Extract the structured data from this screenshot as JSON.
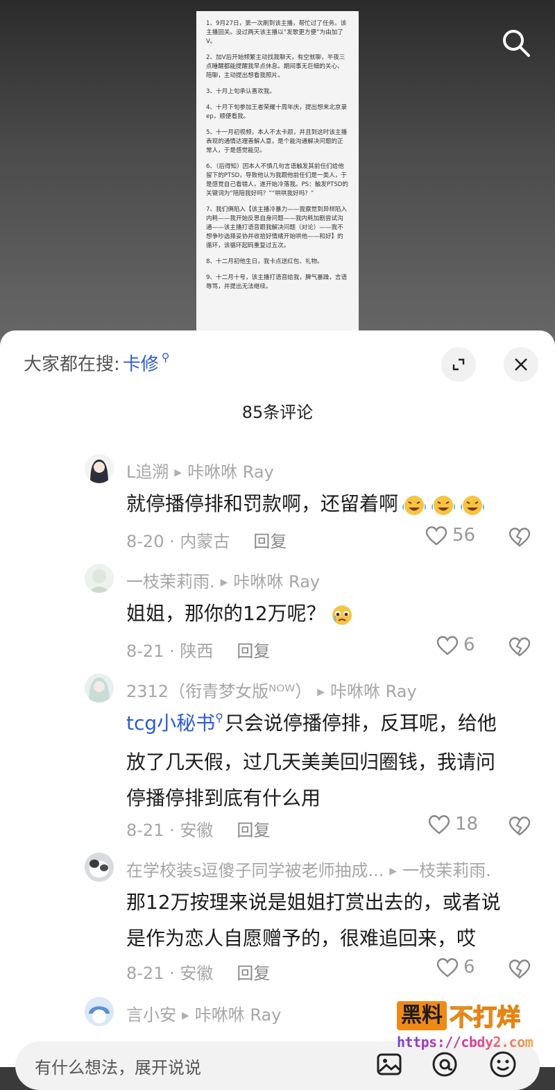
{
  "document": {
    "paragraphs": [
      "1、9月27日，第一次刷到该主播，帮忙过了任务。该主播回关。没过两天该主播以“发歌更方便”为由加了V。",
      "2、加V后开始频繁主动找我聊天，有空就聊，半夜三点睡醒都能提醒我早点休息。期间事无巨细的关心、陪聊，主动提出想看我照片。",
      "3、十月上旬承认喜欢我。",
      "4、十月下旬参加王者荣耀十周年庆，提出想来北京录ep，顺便看我。",
      "5、十一月初视频，本人不太卡颜，并且到这时该主播表现的通情达理善解人意，是个能沟通解决问题的正常人，于是感觉能见。",
      "6、（后得知）因本人不慎几句言语触发其前任们给他留下的PTSD，导致他认为我跟他前任们是一类人，于是感觉自己看错人，遂开始冷落我。PS：触发PTSD的关键词为“陪陪我好吗？”“哄哄我好吗？”",
      "7、我们俩陷入【该主播冷暴力——我察觉到异样陷入内耗——我开始反思自身问题——我内耗加剧尝试沟通——该主播打语音跟我解决问题（对论）——我不想争吵选择妥协并收拾好情绪开始哄他——和好】的循环，该循环起码重复过五次。",
      "8、十二月初他生日，我卡点送红包、礼物。",
      "9、十二月十号，该主播打语音给我，脾气暴躁，言语辱骂，并提出无法继续。"
    ]
  },
  "header": {
    "hot_search_prefix": "大家都在搜:",
    "hot_search_term": "卡修",
    "comment_count": "85条评论"
  },
  "comments": [
    {
      "user": "L追溯",
      "reply_to": "咔咻咻 Ray",
      "text": "就停播停排和罚款啊，还留着啊",
      "emoji": "cry-laugh-emoji x3",
      "date_loc": "8-20 · 内蒙古",
      "reply": "回复",
      "likes": "56"
    },
    {
      "user": "一枝茉莉雨.",
      "reply_to": "咔咻咻 Ray",
      "text": "姐姐，那你的12万呢？",
      "emoji": "pleading-emoji",
      "date_loc": "8-21 · 陕西",
      "reply": "回复",
      "likes": "6"
    },
    {
      "user": "2312（衔青梦女版ᴺᴼᵂ）",
      "reply_to": "咔咻咻 Ray",
      "mention": "tcg小秘书",
      "text_lines": [
        "只会说停播停排，反耳呢，给他",
        "放了几天假，过几天美美回归圈钱，我请问",
        "停播停排到底有什么用"
      ],
      "date_loc": "8-21 · 安徽",
      "reply": "回复",
      "likes": "18"
    },
    {
      "user": "在学校装s逗傻子同学被老师抽成...",
      "reply_to": "一枝茉莉雨.",
      "text_lines": [
        "那12万按理来说是姐姐打赏出去的，或者说",
        "是作为恋人自愿赠予的，很难追回来，哎"
      ],
      "date_loc": "8-21 · 安徽",
      "reply": "回复",
      "likes": "6"
    },
    {
      "user": "言小安",
      "reply_to": "咔咻咻 Ray"
    }
  ],
  "input": {
    "placeholder": "有什么想法，展开说说"
  },
  "watermark": {
    "box": "黑料",
    "text": "不打烊",
    "url": "https://cbdy2.com"
  },
  "colors": {
    "link": "#2b5bd7",
    "meta": "#a6a6a6",
    "watermark_orange": "#f08a16"
  }
}
